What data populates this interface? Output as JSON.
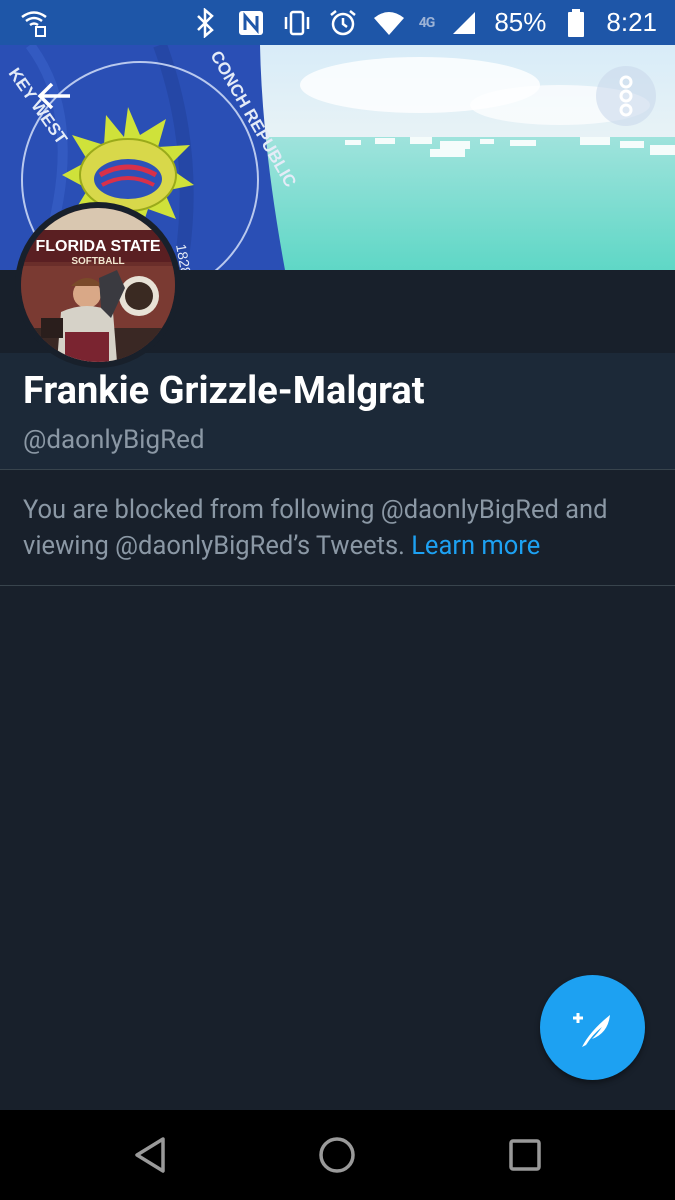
{
  "status_bar": {
    "network_label": "4G",
    "battery": "85%",
    "time": "8:21"
  },
  "banner": {
    "flag_text_left": "KEY WEST",
    "flag_text_right": "CONCH REPUBLIC",
    "flag_year": "1828"
  },
  "avatar": {
    "sign_title": "FLORIDA STATE",
    "sign_subtitle": "SOFTBALL"
  },
  "profile": {
    "name": "Frankie Grizzle-Malgrat",
    "handle": "@daonlyBigRed"
  },
  "blocked_notice": {
    "text": "You are blocked from following @daonlyBigRed and viewing @daonlyBigRed’s Tweets. ",
    "link": "Learn more"
  },
  "colors": {
    "status_bar": "#1e56a8",
    "background": "#18202b",
    "name_panel": "#1c2938",
    "accent": "#1da1f2",
    "muted_text": "#8b98a5"
  },
  "icons": {
    "back": "arrow-left-icon",
    "more": "more-vertical-icon",
    "compose": "compose-tweet-icon",
    "nav_back": "triangle-back-icon",
    "nav_home": "circle-home-icon",
    "nav_recents": "square-recents-icon"
  }
}
